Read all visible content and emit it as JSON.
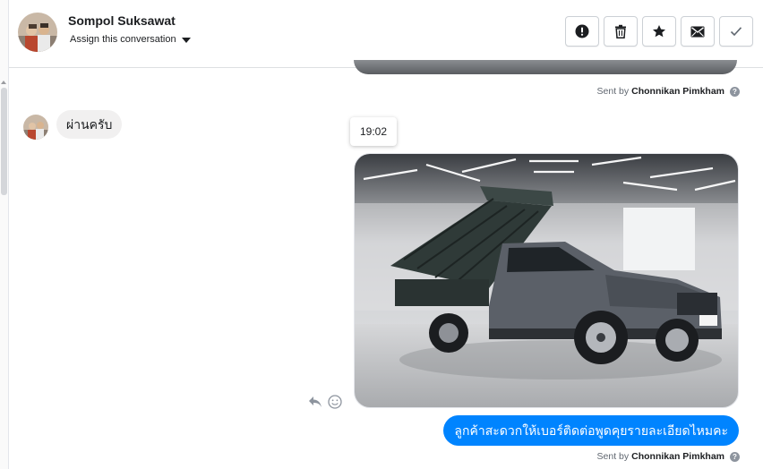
{
  "header": {
    "contact_name": "Sompol Suksawat",
    "assign_label": "Assign this conversation",
    "actions": [
      {
        "id": "spam",
        "icon": "exclamation-circle-icon"
      },
      {
        "id": "delete",
        "icon": "trash-icon"
      },
      {
        "id": "star",
        "icon": "star-icon"
      },
      {
        "id": "mark-unread",
        "icon": "envelope-icon"
      },
      {
        "id": "done",
        "icon": "checkmark-icon"
      }
    ]
  },
  "thread": {
    "previous_sent_by_prefix": "Sent by",
    "previous_sent_by_name": "Chonnikan Pimkham",
    "incoming_message": "ผ่านครับ",
    "timestamp_tooltip": "19:02",
    "photo_alt_icon": "pickup-truck-photo",
    "outgoing_message": "ลูกค้าสะดวกให้เบอร์ติดต่อพูดคุยรายละเอียดไหมคะ",
    "last_sent_by_prefix": "Sent by",
    "last_sent_by_name": "Chonnikan Pimkham",
    "help_glyph": "?"
  },
  "colors": {
    "accent": "#0084ff",
    "incoming_bubble": "#f1f0f0",
    "border": "#ccd0d5"
  }
}
